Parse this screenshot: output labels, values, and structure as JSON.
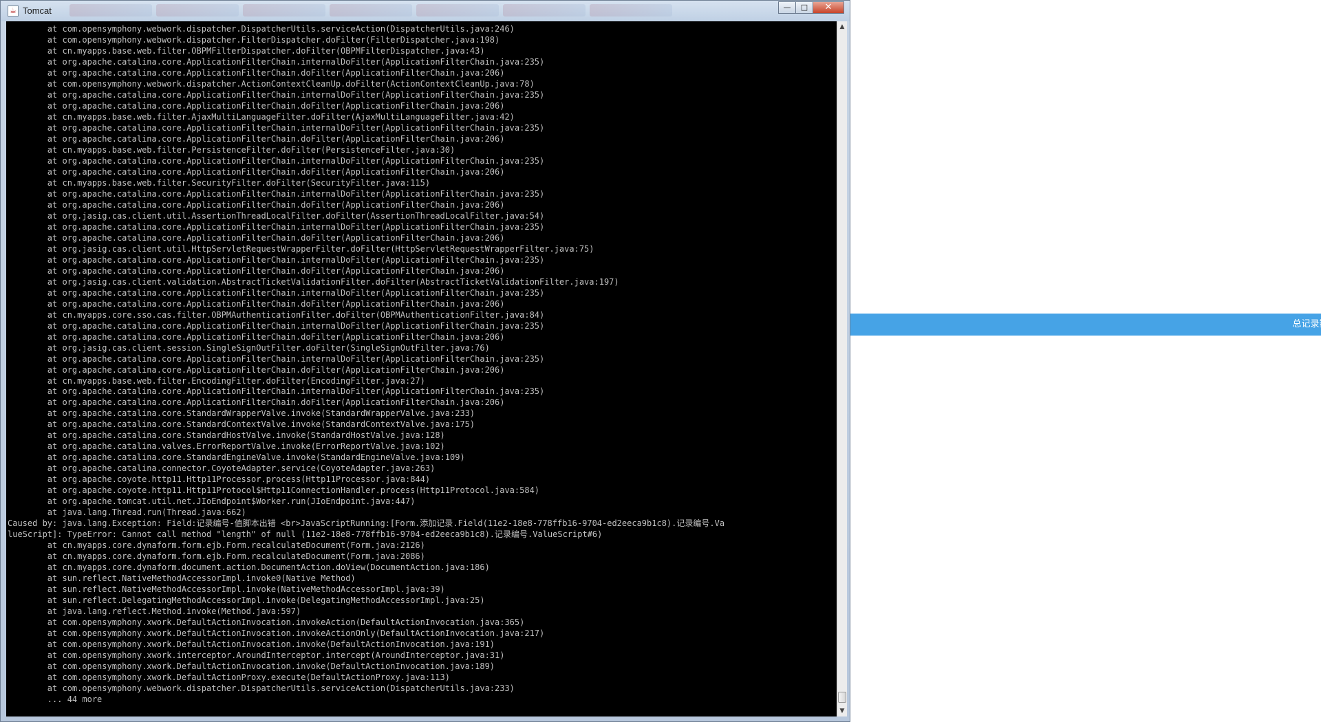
{
  "window": {
    "title": "Tomcat",
    "buttons": {
      "minimize": "—",
      "maximize": "□",
      "close": "✕"
    }
  },
  "background_page": {
    "status_text": "总记录数:("
  },
  "console": {
    "lines": [
      "        at com.opensymphony.webwork.dispatcher.DispatcherUtils.serviceAction(DispatcherUtils.java:246)",
      "        at com.opensymphony.webwork.dispatcher.FilterDispatcher.doFilter(FilterDispatcher.java:198)",
      "        at cn.myapps.base.web.filter.OBPMFilterDispatcher.doFilter(OBPMFilterDispatcher.java:43)",
      "        at org.apache.catalina.core.ApplicationFilterChain.internalDoFilter(ApplicationFilterChain.java:235)",
      "        at org.apache.catalina.core.ApplicationFilterChain.doFilter(ApplicationFilterChain.java:206)",
      "        at com.opensymphony.webwork.dispatcher.ActionContextCleanUp.doFilter(ActionContextCleanUp.java:78)",
      "        at org.apache.catalina.core.ApplicationFilterChain.internalDoFilter(ApplicationFilterChain.java:235)",
      "        at org.apache.catalina.core.ApplicationFilterChain.doFilter(ApplicationFilterChain.java:206)",
      "        at cn.myapps.base.web.filter.AjaxMultiLanguageFilter.doFilter(AjaxMultiLanguageFilter.java:42)",
      "        at org.apache.catalina.core.ApplicationFilterChain.internalDoFilter(ApplicationFilterChain.java:235)",
      "        at org.apache.catalina.core.ApplicationFilterChain.doFilter(ApplicationFilterChain.java:206)",
      "        at cn.myapps.base.web.filter.PersistenceFilter.doFilter(PersistenceFilter.java:30)",
      "        at org.apache.catalina.core.ApplicationFilterChain.internalDoFilter(ApplicationFilterChain.java:235)",
      "        at org.apache.catalina.core.ApplicationFilterChain.doFilter(ApplicationFilterChain.java:206)",
      "        at cn.myapps.base.web.filter.SecurityFilter.doFilter(SecurityFilter.java:115)",
      "        at org.apache.catalina.core.ApplicationFilterChain.internalDoFilter(ApplicationFilterChain.java:235)",
      "        at org.apache.catalina.core.ApplicationFilterChain.doFilter(ApplicationFilterChain.java:206)",
      "        at org.jasig.cas.client.util.AssertionThreadLocalFilter.doFilter(AssertionThreadLocalFilter.java:54)",
      "        at org.apache.catalina.core.ApplicationFilterChain.internalDoFilter(ApplicationFilterChain.java:235)",
      "        at org.apache.catalina.core.ApplicationFilterChain.doFilter(ApplicationFilterChain.java:206)",
      "        at org.jasig.cas.client.util.HttpServletRequestWrapperFilter.doFilter(HttpServletRequestWrapperFilter.java:75)",
      "        at org.apache.catalina.core.ApplicationFilterChain.internalDoFilter(ApplicationFilterChain.java:235)",
      "        at org.apache.catalina.core.ApplicationFilterChain.doFilter(ApplicationFilterChain.java:206)",
      "        at org.jasig.cas.client.validation.AbstractTicketValidationFilter.doFilter(AbstractTicketValidationFilter.java:197)",
      "        at org.apache.catalina.core.ApplicationFilterChain.internalDoFilter(ApplicationFilterChain.java:235)",
      "        at org.apache.catalina.core.ApplicationFilterChain.doFilter(ApplicationFilterChain.java:206)",
      "        at cn.myapps.core.sso.cas.filter.OBPMAuthenticationFilter.doFilter(OBPMAuthenticationFilter.java:84)",
      "        at org.apache.catalina.core.ApplicationFilterChain.internalDoFilter(ApplicationFilterChain.java:235)",
      "        at org.apache.catalina.core.ApplicationFilterChain.doFilter(ApplicationFilterChain.java:206)",
      "        at org.jasig.cas.client.session.SingleSignOutFilter.doFilter(SingleSignOutFilter.java:76)",
      "        at org.apache.catalina.core.ApplicationFilterChain.internalDoFilter(ApplicationFilterChain.java:235)",
      "        at org.apache.catalina.core.ApplicationFilterChain.doFilter(ApplicationFilterChain.java:206)",
      "        at cn.myapps.base.web.filter.EncodingFilter.doFilter(EncodingFilter.java:27)",
      "        at org.apache.catalina.core.ApplicationFilterChain.internalDoFilter(ApplicationFilterChain.java:235)",
      "        at org.apache.catalina.core.ApplicationFilterChain.doFilter(ApplicationFilterChain.java:206)",
      "        at org.apache.catalina.core.StandardWrapperValve.invoke(StandardWrapperValve.java:233)",
      "        at org.apache.catalina.core.StandardContextValve.invoke(StandardContextValve.java:175)",
      "        at org.apache.catalina.core.StandardHostValve.invoke(StandardHostValve.java:128)",
      "        at org.apache.catalina.valves.ErrorReportValve.invoke(ErrorReportValve.java:102)",
      "        at org.apache.catalina.core.StandardEngineValve.invoke(StandardEngineValve.java:109)",
      "        at org.apache.catalina.connector.CoyoteAdapter.service(CoyoteAdapter.java:263)",
      "        at org.apache.coyote.http11.Http11Processor.process(Http11Processor.java:844)",
      "        at org.apache.coyote.http11.Http11Protocol$Http11ConnectionHandler.process(Http11Protocol.java:584)",
      "        at org.apache.tomcat.util.net.JIoEndpoint$Worker.run(JIoEndpoint.java:447)",
      "        at java.lang.Thread.run(Thread.java:662)",
      "Caused by: java.lang.Exception: Field:记录编号-值脚本出错 <br>JavaScriptRunning:[Form.添加记录.Field(11e2-18e8-778ffb16-9704-ed2eeca9b1c8).记录编号.Va",
      "lueScript]: TypeError: Cannot call method \"length\" of null (11e2-18e8-778ffb16-9704-ed2eeca9b1c8).记录编号.ValueScript#6)",
      "        at cn.myapps.core.dynaform.form.ejb.Form.recalculateDocument(Form.java:2126)",
      "        at cn.myapps.core.dynaform.form.ejb.Form.recalculateDocument(Form.java:2086)",
      "        at cn.myapps.core.dynaform.document.action.DocumentAction.doView(DocumentAction.java:186)",
      "        at sun.reflect.NativeMethodAccessorImpl.invoke0(Native Method)",
      "        at sun.reflect.NativeMethodAccessorImpl.invoke(NativeMethodAccessorImpl.java:39)",
      "        at sun.reflect.DelegatingMethodAccessorImpl.invoke(DelegatingMethodAccessorImpl.java:25)",
      "        at java.lang.reflect.Method.invoke(Method.java:597)",
      "        at com.opensymphony.xwork.DefaultActionInvocation.invokeAction(DefaultActionInvocation.java:365)",
      "        at com.opensymphony.xwork.DefaultActionInvocation.invokeActionOnly(DefaultActionInvocation.java:217)",
      "        at com.opensymphony.xwork.DefaultActionInvocation.invoke(DefaultActionInvocation.java:191)",
      "        at com.opensymphony.xwork.interceptor.AroundInterceptor.intercept(AroundInterceptor.java:31)",
      "        at com.opensymphony.xwork.DefaultActionInvocation.invoke(DefaultActionInvocation.java:189)",
      "        at com.opensymphony.xwork.DefaultActionProxy.execute(DefaultActionProxy.java:113)",
      "        at com.opensymphony.webwork.dispatcher.DispatcherUtils.serviceAction(DispatcherUtils.java:233)",
      "        ... 44 more"
    ]
  }
}
